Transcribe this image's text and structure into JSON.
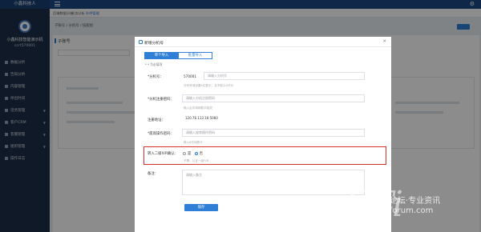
{
  "app": {
    "title": "小鑫科技人"
  },
  "sidebar": {
    "org_name": "小鑫科技智能演示机",
    "org_id": "ccrt570001",
    "items": [
      {
        "label": "数据分析",
        "icon": "chart-icon"
      },
      {
        "label": "告知分析",
        "icon": "bell-icon"
      },
      {
        "label": "内容管理",
        "icon": "doc-icon"
      },
      {
        "label": "呼出时间",
        "icon": "clock-icon"
      },
      {
        "label": "话务管理",
        "icon": "phone-icon",
        "has_caret": true
      },
      {
        "label": "客户CRM",
        "icon": "users-icon",
        "has_caret": true
      },
      {
        "label": "客服管理",
        "icon": "headset-icon",
        "has_caret": true
      },
      {
        "label": "组织管理",
        "icon": "org-icon",
        "has_caret": true
      },
      {
        "label": "操作日志",
        "icon": "log-icon"
      }
    ]
  },
  "page_tabs": [
    "后端数据分析",
    "任务分析",
    "外呼管理"
  ],
  "background": {
    "breadcrumb": "子账号 / 分机号 / 技能组",
    "panel_title": "子账号"
  },
  "modal": {
    "title": "新增分机号",
    "segments": [
      "单个导入",
      "批量导入"
    ],
    "required_note": "* * 为必填项",
    "fields": [
      {
        "label": "*分机号：",
        "value": "570001",
        "placeholder": "请输入分机号",
        "hint": "分机号请设置4位数字，且不能以0开头"
      },
      {
        "label": "*分机注册密码：",
        "placeholder": "请输入分机注册密码",
        "hint": "输入由字母和数字组成"
      },
      {
        "label": "注册地址：",
        "value": "120.76.113.16:5060"
      },
      {
        "label": "*座席操作密码：",
        "placeholder": "请输入座席操作密码",
        "hint": "输入6位纯数字"
      }
    ],
    "inbound_label": "转入二级IVR确认：",
    "radio_options": [
      "是",
      "否"
    ],
    "radio_selected": "否",
    "inbound_hint": "不需，认证一级IVR",
    "remark_label": "备注：",
    "remark_placeholder": "请输入备注",
    "save_label": "保存"
  },
  "watermark": {
    "brand": "CTi",
    "line1": "论坛·专业资讯",
    "line2": "forum.com"
  }
}
